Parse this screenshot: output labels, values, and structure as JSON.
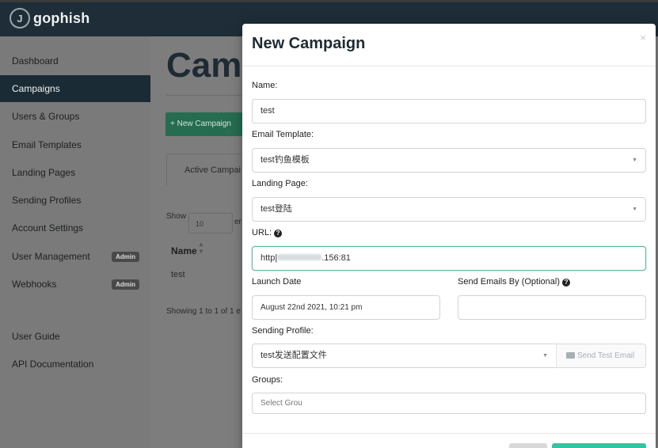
{
  "app": {
    "brand": "gophish",
    "logo_letter": "J"
  },
  "sidebar": {
    "items": [
      {
        "label": "Dashboard"
      },
      {
        "label": "Campaigns",
        "active": true
      },
      {
        "label": "Users & Groups"
      },
      {
        "label": "Email Templates"
      },
      {
        "label": "Landing Pages"
      },
      {
        "label": "Sending Profiles"
      },
      {
        "label": "Account Settings"
      },
      {
        "label": "User Management",
        "badge": "Admin"
      },
      {
        "label": "Webhooks",
        "badge": "Admin"
      },
      {
        "label": "User Guide"
      },
      {
        "label": "API Documentation"
      }
    ]
  },
  "main": {
    "title": "Cam",
    "new_button": "+ New Campaign",
    "tab_active": "Active Campai",
    "show_label": "Show",
    "show_value": "10",
    "show_tail": "er",
    "column_name": "Name",
    "row_name": "test",
    "showing_text": "Showing 1 to 1 of 1 e"
  },
  "modal": {
    "title": "New Campaign",
    "close": "×",
    "name_label": "Name:",
    "name_value": "test",
    "template_label": "Email Template:",
    "template_value": "test钓鱼模板",
    "landing_label": "Landing Page:",
    "landing_value": "test登陆",
    "url_label": "URL:",
    "url_prefix": "http",
    "url_suffix": ".156:81",
    "launch_label": "Launch Date",
    "launch_value": "August 22nd 2021, 10:21 pm",
    "send_by_label": "Send Emails By (Optional)",
    "send_by_value": "",
    "profile_label": "Sending Profile:",
    "profile_value": "test发送配置文件",
    "send_test_label": "Send Test Email",
    "groups_label": "Groups:",
    "groups_placeholder": "Select Grou"
  },
  "colors": {
    "topbar": "#1e2d37",
    "active_nav": "#1b2b35",
    "accent_green": "#37c2a2",
    "focus_border": "#5cb89a"
  }
}
